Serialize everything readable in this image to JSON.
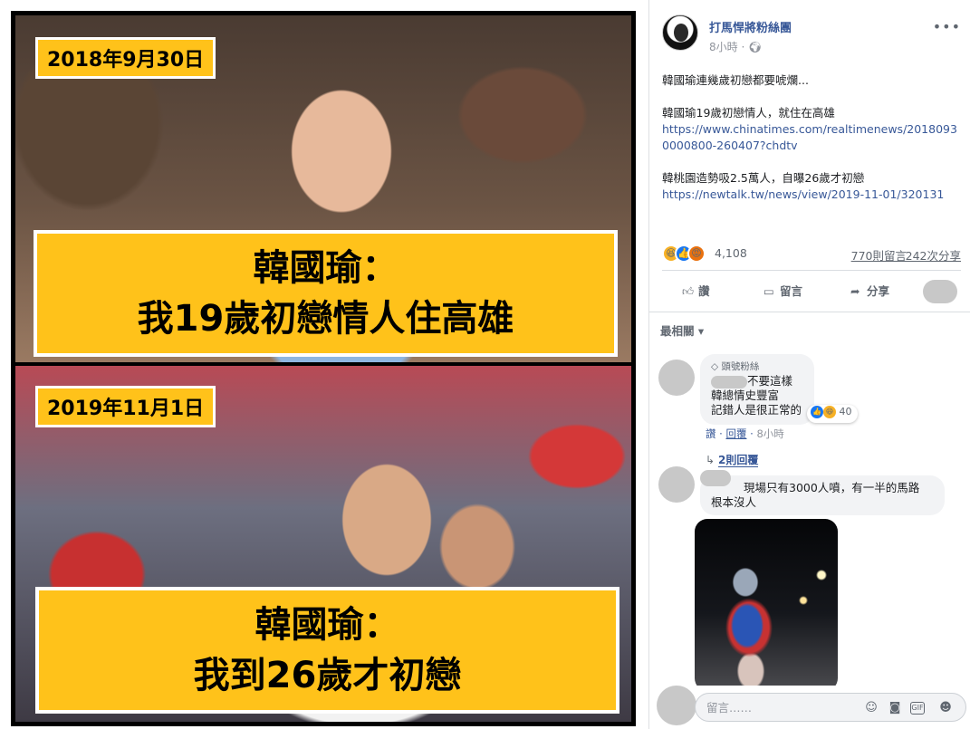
{
  "image_post": {
    "panel_1": {
      "date": "2018年9月30日",
      "caption_line_1": "韓國瑜：",
      "caption_line_2": "我19歲初戀情人住高雄"
    },
    "panel_2": {
      "date": "2019年11月1日",
      "caption_line_1": "韓國瑜：",
      "caption_line_2": "我到26歲才初戀"
    }
  },
  "post": {
    "page_name": "打馬悍將粉絲團",
    "time": "8小時",
    "privacy_icon": "globe-icon",
    "text": {
      "p1": "韓國瑜連幾歲初戀都要唬爛...",
      "p2_line": "韓國瑜19歲初戀情人，就住在高雄",
      "p2_link": "https://www.chinatimes.com/realtimenews/20180930000800-260407?chdtv",
      "p3_line": "韓桃園造勢吸2.5萬人，自曝26歲才初戀",
      "p3_link": "https://newtalk.tw/news/view/2019-11-01/320131"
    },
    "reaction_count": "4,108",
    "comment_count": "770則留言",
    "share_count": "242次分享",
    "actions": {
      "like": "讚",
      "comment": "留言",
      "share": "分享"
    }
  },
  "comments": {
    "sort": "最相關",
    "c1": {
      "badge": "頭號粉絲",
      "line1": "不要這樣",
      "line2": "韓總情史豐富",
      "line3": "記錯人是很正常的",
      "reactions": "40",
      "like": "讚",
      "reply": "回覆",
      "time": "8小時",
      "replies": "2則回覆"
    },
    "c2": {
      "line1": "現場只有3000人噴，有一半的馬路",
      "line2": "根本沒人"
    }
  },
  "composer": {
    "placeholder": "留言……"
  },
  "colors": {
    "caption_yellow": "#ffc21a",
    "link_blue": "#385898"
  }
}
